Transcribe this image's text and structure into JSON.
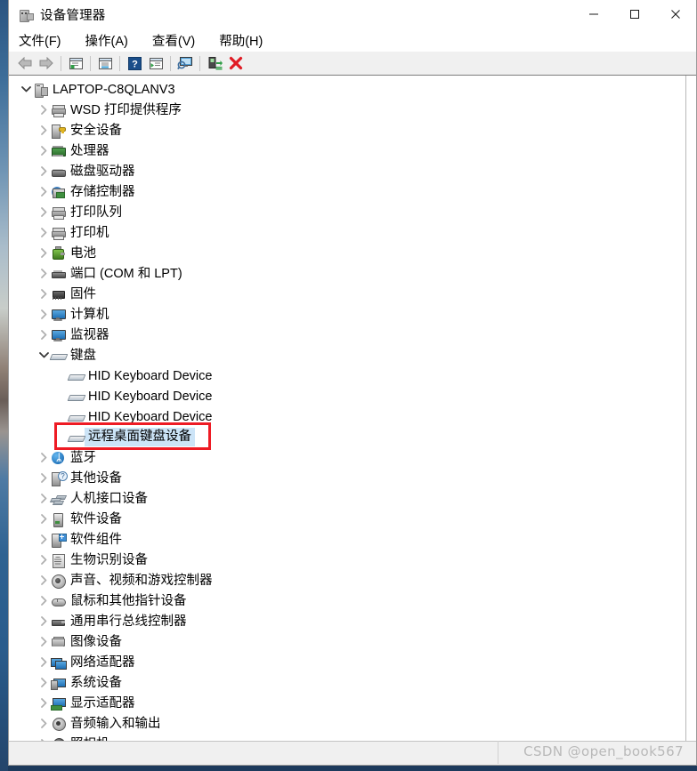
{
  "window": {
    "title": "设备管理器",
    "app_icon": "device-manager-icon",
    "caption": {
      "minimize": "minimize-icon",
      "maximize": "maximize-icon",
      "close": "close-icon"
    }
  },
  "menubar": {
    "items": [
      {
        "label": "文件(F)",
        "name": "menu-file"
      },
      {
        "label": "操作(A)",
        "name": "menu-action"
      },
      {
        "label": "查看(V)",
        "name": "menu-view"
      },
      {
        "label": "帮助(H)",
        "name": "menu-help"
      }
    ]
  },
  "toolbar": {
    "buttons": [
      {
        "name": "back-button",
        "icon": "arrow-left-icon"
      },
      {
        "name": "forward-button",
        "icon": "arrow-right-icon"
      },
      {
        "sep": true
      },
      {
        "name": "properties-button",
        "icon": "properties-window-icon"
      },
      {
        "sep": true
      },
      {
        "name": "update-driver-button",
        "icon": "document-window-icon"
      },
      {
        "sep": true
      },
      {
        "name": "help-button",
        "icon": "question-mark-icon"
      },
      {
        "name": "show-hidden-button",
        "icon": "play-window-icon"
      },
      {
        "sep": true
      },
      {
        "name": "scan-hardware-button",
        "icon": "monitor-search-icon"
      },
      {
        "sep": true
      },
      {
        "name": "enable-device-button",
        "icon": "device-enable-icon"
      },
      {
        "name": "uninstall-device-button",
        "icon": "red-x-icon"
      }
    ]
  },
  "tree": {
    "root": {
      "label": "LAPTOP-C8QLANV3",
      "icon": "computer-icon",
      "expanded": true,
      "twisty": "chevron-down-icon"
    },
    "nodes": [
      {
        "label": "WSD 打印提供程序",
        "icon": "printer-icon",
        "icon_class": "printer",
        "depth": 1,
        "twisty": "chevron-right-icon",
        "selected": false
      },
      {
        "label": "安全设备",
        "icon": "security-device-icon",
        "icon_class": "lock-dev",
        "depth": 1,
        "twisty": "chevron-right-icon",
        "selected": false
      },
      {
        "label": "处理器",
        "icon": "processor-icon",
        "icon_class": "chip",
        "depth": 1,
        "twisty": "chevron-right-icon",
        "selected": false
      },
      {
        "label": "磁盘驱动器",
        "icon": "disk-drive-icon",
        "icon_class": "disk",
        "depth": 1,
        "twisty": "chevron-right-icon",
        "selected": false
      },
      {
        "label": "存储控制器",
        "icon": "storage-controller-icon",
        "icon_class": "storage",
        "depth": 1,
        "twisty": "chevron-right-icon",
        "selected": false
      },
      {
        "label": "打印队列",
        "icon": "print-queue-icon",
        "icon_class": "printer",
        "depth": 1,
        "twisty": "chevron-right-icon",
        "selected": false
      },
      {
        "label": "打印机",
        "icon": "printer-icon",
        "icon_class": "printer",
        "depth": 1,
        "twisty": "chevron-right-icon",
        "selected": false
      },
      {
        "label": "电池",
        "icon": "battery-icon",
        "icon_class": "battery",
        "depth": 1,
        "twisty": "chevron-right-icon",
        "selected": false
      },
      {
        "label": "端口 (COM 和 LPT)",
        "icon": "port-icon",
        "icon_class": "port",
        "depth": 1,
        "twisty": "chevron-right-icon",
        "selected": false
      },
      {
        "label": "固件",
        "icon": "firmware-icon",
        "icon_class": "firmware",
        "depth": 1,
        "twisty": "chevron-right-icon",
        "selected": false
      },
      {
        "label": "计算机",
        "icon": "computer-monitor-icon",
        "icon_class": "monitor",
        "depth": 1,
        "twisty": "chevron-right-icon",
        "selected": false
      },
      {
        "label": "监视器",
        "icon": "monitor-icon",
        "icon_class": "monitor",
        "depth": 1,
        "twisty": "chevron-right-icon",
        "selected": false
      },
      {
        "label": "键盘",
        "icon": "keyboard-icon",
        "icon_class": "keyboard",
        "depth": 1,
        "twisty": "chevron-down-icon",
        "selected": false
      },
      {
        "label": "HID Keyboard Device",
        "icon": "keyboard-icon",
        "icon_class": "keyboard",
        "depth": 2,
        "twisty": "",
        "selected": false
      },
      {
        "label": "HID Keyboard Device",
        "icon": "keyboard-icon",
        "icon_class": "keyboard",
        "depth": 2,
        "twisty": "",
        "selected": false
      },
      {
        "label": "HID Keyboard Device",
        "icon": "keyboard-icon",
        "icon_class": "keyboard",
        "depth": 2,
        "twisty": "",
        "selected": false
      },
      {
        "label": "远程桌面键盘设备",
        "icon": "keyboard-icon",
        "icon_class": "keyboard",
        "depth": 2,
        "twisty": "",
        "selected": true
      },
      {
        "label": "蓝牙",
        "icon": "bluetooth-icon",
        "icon_class": "bluetooth",
        "depth": 1,
        "twisty": "chevron-right-icon",
        "selected": false
      },
      {
        "label": "其他设备",
        "icon": "unknown-device-icon",
        "icon_class": "unknown",
        "depth": 1,
        "twisty": "chevron-right-icon",
        "selected": false
      },
      {
        "label": "人机接口设备",
        "icon": "human-interface-device-icon",
        "icon_class": "hid",
        "depth": 1,
        "twisty": "chevron-right-icon",
        "selected": false
      },
      {
        "label": "软件设备",
        "icon": "software-device-icon",
        "icon_class": "softdev",
        "depth": 1,
        "twisty": "chevron-right-icon",
        "selected": false
      },
      {
        "label": "软件组件",
        "icon": "software-component-icon",
        "icon_class": "softcomp",
        "depth": 1,
        "twisty": "chevron-right-icon",
        "selected": false
      },
      {
        "label": "生物识别设备",
        "icon": "biometric-device-icon",
        "icon_class": "biometric",
        "depth": 1,
        "twisty": "chevron-right-icon",
        "selected": false
      },
      {
        "label": "声音、视频和游戏控制器",
        "icon": "sound-video-game-controller-icon",
        "icon_class": "speaker",
        "depth": 1,
        "twisty": "chevron-right-icon",
        "selected": false
      },
      {
        "label": "鼠标和其他指针设备",
        "icon": "mouse-icon",
        "icon_class": "mouse",
        "depth": 1,
        "twisty": "chevron-right-icon",
        "selected": false
      },
      {
        "label": "通用串行总线控制器",
        "icon": "usb-controller-icon",
        "icon_class": "usb",
        "depth": 1,
        "twisty": "chevron-right-icon",
        "selected": false
      },
      {
        "label": "图像设备",
        "icon": "imaging-device-icon",
        "icon_class": "imaging",
        "depth": 1,
        "twisty": "chevron-right-icon",
        "selected": false
      },
      {
        "label": "网络适配器",
        "icon": "network-adapter-icon",
        "icon_class": "network",
        "depth": 1,
        "twisty": "chevron-right-icon",
        "selected": false
      },
      {
        "label": "系统设备",
        "icon": "system-device-icon",
        "icon_class": "sysdev",
        "depth": 1,
        "twisty": "chevron-right-icon",
        "selected": false
      },
      {
        "label": "显示适配器",
        "icon": "display-adapter-icon",
        "icon_class": "display",
        "depth": 1,
        "twisty": "chevron-right-icon",
        "selected": false
      },
      {
        "label": "音频输入和输出",
        "icon": "audio-io-icon",
        "icon_class": "audio",
        "depth": 1,
        "twisty": "chevron-right-icon",
        "selected": false
      },
      {
        "label": "照相机",
        "icon": "camera-icon",
        "icon_class": "camera",
        "depth": 1,
        "twisty": "chevron-right-icon",
        "selected": false
      }
    ]
  },
  "annotation": {
    "type": "red-rectangle",
    "color": "#ee1b24",
    "targets_label": "远程桌面键盘设备"
  },
  "statusbar": {
    "text": ""
  },
  "watermark": {
    "text": "CSDN @open_book567"
  }
}
